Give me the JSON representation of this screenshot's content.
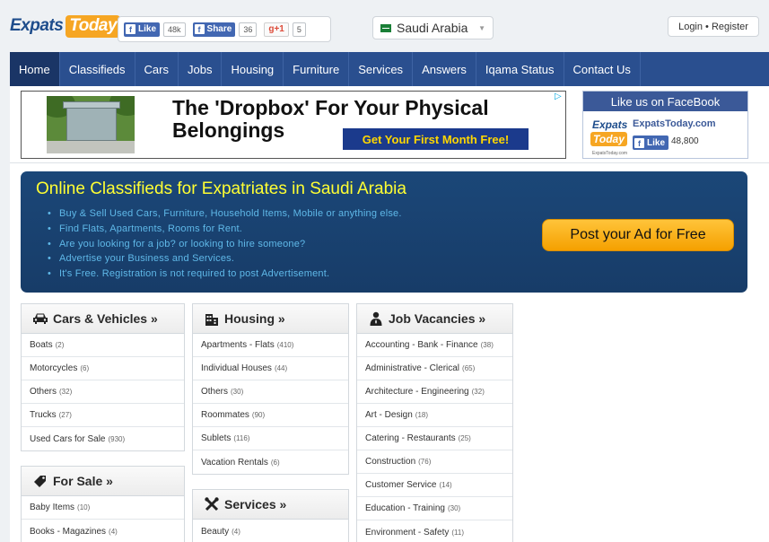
{
  "logo": {
    "part1": "Expats",
    "part2": "Today"
  },
  "social": {
    "fb_like_label": "Like",
    "fb_like_count": "48k",
    "fb_share_label": "Share",
    "fb_share_count": "36",
    "gplus_label": "g+1",
    "gplus_count": "5"
  },
  "country": {
    "name": "Saudi Arabia"
  },
  "auth": {
    "label": "Login • Register"
  },
  "nav": {
    "items": [
      "Home",
      "Classifieds",
      "Cars",
      "Jobs",
      "Housing",
      "Furniture",
      "Services",
      "Answers",
      "Iqama Status",
      "Contact Us"
    ],
    "active": "Home"
  },
  "ad": {
    "headline": "The 'Dropbox' For Your Physical Belongings",
    "cta": "Get Your First Month Free!"
  },
  "facebook_box": {
    "title": "Like us on FaceBook",
    "site_name": "ExpatsToday.com",
    "like_label": "Like",
    "like_count": "48,800",
    "logo_part1": "Expats",
    "logo_part2": "Today",
    "small_text": "ExpatsToday.com"
  },
  "hero": {
    "title": "Online Classifieds for Expatriates in Saudi Arabia",
    "bullets": [
      "Buy & Sell Used Cars, Furniture, Household Items, Mobile or anything else.",
      "Find Flats, Apartments, Rooms for Rent.",
      "Are you looking for a job? or looking to hire someone?",
      "Advertise your Business and Services.",
      "It's Free. Registration is not required to post Advertisement."
    ],
    "button": "Post your Ad for Free"
  },
  "categories": {
    "cars": {
      "title": "Cars & Vehicles »",
      "icon": "car-icon",
      "items": [
        {
          "label": "Boats",
          "count": "(2)"
        },
        {
          "label": "Motorcycles",
          "count": "(6)"
        },
        {
          "label": "Others",
          "count": "(32)"
        },
        {
          "label": "Trucks",
          "count": "(27)"
        },
        {
          "label": "Used Cars for Sale",
          "count": "(930)"
        }
      ]
    },
    "forsale": {
      "title": "For Sale »",
      "icon": "tag-icon",
      "items": [
        {
          "label": "Baby Items",
          "count": "(10)"
        },
        {
          "label": "Books - Magazines",
          "count": "(4)"
        }
      ]
    },
    "housing": {
      "title": "Housing »",
      "icon": "building-icon",
      "items": [
        {
          "label": "Apartments - Flats",
          "count": "(410)"
        },
        {
          "label": "Individual Houses",
          "count": "(44)"
        },
        {
          "label": "Others",
          "count": "(30)"
        },
        {
          "label": "Roommates",
          "count": "(90)"
        },
        {
          "label": "Sublets",
          "count": "(116)"
        },
        {
          "label": "Vacation Rentals",
          "count": "(6)"
        }
      ]
    },
    "services": {
      "title": "Services »",
      "icon": "tools-icon",
      "items": [
        {
          "label": "Beauty",
          "count": "(4)"
        }
      ]
    },
    "jobs": {
      "title": "Job Vacancies »",
      "icon": "person-icon",
      "items": [
        {
          "label": "Accounting - Bank - Finance",
          "count": "(38)"
        },
        {
          "label": "Administrative - Clerical",
          "count": "(65)"
        },
        {
          "label": "Architecture - Engineering",
          "count": "(32)"
        },
        {
          "label": "Art - Design",
          "count": "(18)"
        },
        {
          "label": "Catering - Restaurants",
          "count": "(25)"
        },
        {
          "label": "Construction",
          "count": "(76)"
        },
        {
          "label": "Customer Service",
          "count": "(14)"
        },
        {
          "label": "Education - Training",
          "count": "(30)"
        },
        {
          "label": "Environment - Safety",
          "count": "(11)"
        }
      ]
    }
  },
  "colors": {
    "nav_bg": "#2a4f8f",
    "hero_bg": "#1b4778",
    "hero_title": "#ffff33",
    "accent_orange": "#f6a623"
  }
}
